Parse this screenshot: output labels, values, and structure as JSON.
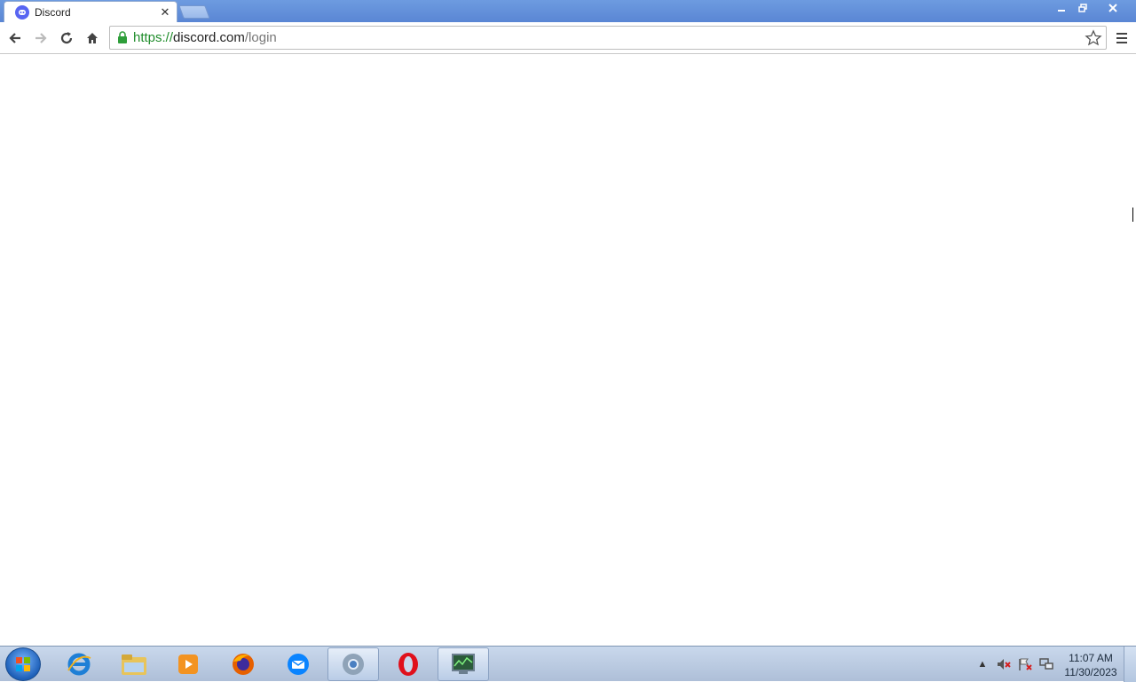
{
  "browser": {
    "tab": {
      "title": "Discord",
      "favicon": "discord-icon"
    },
    "window_controls": {
      "minimize": "minimize-icon",
      "maximize": "restore-icon",
      "close": "close-icon"
    },
    "nav": {
      "back": "back-arrow-icon",
      "forward": "forward-arrow-icon",
      "reload": "reload-icon",
      "home": "home-icon"
    },
    "address": {
      "scheme": "https://",
      "host": "discord.com",
      "path": "/login"
    }
  },
  "taskbar": {
    "pinned": [
      {
        "name": "internet-explorer-icon"
      },
      {
        "name": "file-explorer-icon"
      },
      {
        "name": "media-player-icon"
      },
      {
        "name": "firefox-icon"
      },
      {
        "name": "thunderbird-icon"
      },
      {
        "name": "chrome-icon",
        "active": true
      },
      {
        "name": "opera-icon"
      },
      {
        "name": "task-manager-icon"
      }
    ],
    "clock": {
      "time": "11:07 AM",
      "date": "11/30/2023"
    }
  },
  "colors": {
    "titlebar": "#5a86d4",
    "discord": "#5865f2",
    "secure_url": "#1e8c2a"
  }
}
